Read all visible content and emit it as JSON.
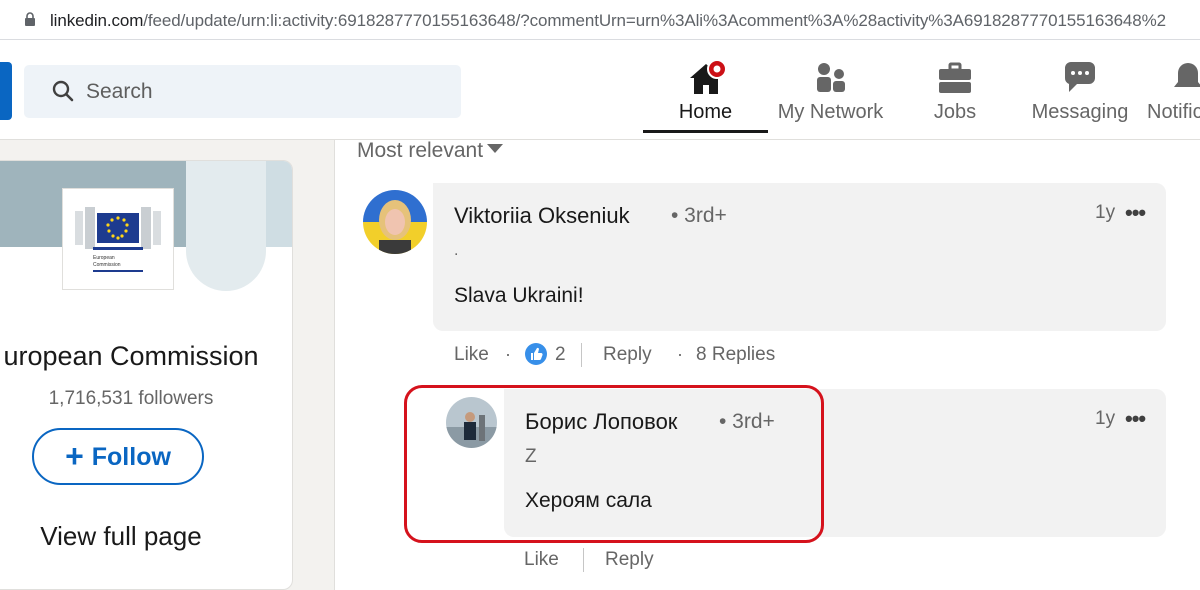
{
  "browser": {
    "url_host": "linkedin.com",
    "url_path": "/feed/update/urn:li:activity:6918287770155163648/?commentUrn=urn%3Ali%3Acomment%3A%28activity%3A6918287770155163648%2"
  },
  "topnav": {
    "search_placeholder": "Search",
    "items": [
      {
        "label": "Home",
        "icon": "home-icon",
        "active": true
      },
      {
        "label": "My Network",
        "icon": "network-icon"
      },
      {
        "label": "Jobs",
        "icon": "briefcase-icon"
      },
      {
        "label": "Messaging",
        "icon": "messaging-icon"
      },
      {
        "label": "Notific",
        "icon": "bell-icon"
      }
    ],
    "notification_badge_color": "#cc1016"
  },
  "sidebar": {
    "org_name": "uropean Commission",
    "followers": "1,716,531 followers",
    "follow_label": "Follow",
    "follow_plus": "+",
    "view_full_page": "View full page",
    "logo_text_1": "European",
    "logo_text_2": "Commission"
  },
  "comments": {
    "sort_label": "Most relevant",
    "items": [
      {
        "author": "Viktoriia Okseniuk",
        "degree": "• 3rd+",
        "time": "1y",
        "headline": ".",
        "text": "Slava Ukraini!",
        "like_label": "Like",
        "reaction_count": "2",
        "reply_label": "Reply",
        "replies_label": "8 Replies"
      },
      {
        "author": "Борис Лоповок",
        "degree": "• 3rd+",
        "time": "1y",
        "headline": "Z",
        "text": "Хероям сала",
        "like_label": "Like",
        "reply_label": "Reply"
      }
    ],
    "more_glyph": "•••",
    "dot_glyph": "·"
  },
  "colors": {
    "brand": "#0a66c2",
    "highlight": "#d5121c"
  }
}
